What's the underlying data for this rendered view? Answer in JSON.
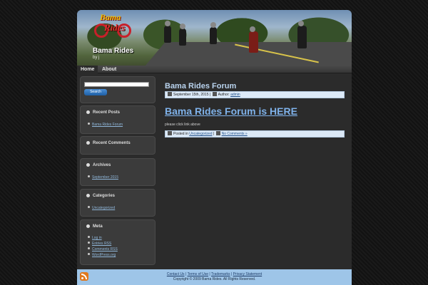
{
  "header": {
    "logo_top": "Bama",
    "logo_bottom": "Rides",
    "site_title": "Bama Rides",
    "site_desc": "by j"
  },
  "nav": {
    "home": "Home",
    "about": "About"
  },
  "search": {
    "value": "",
    "button_label": "Search"
  },
  "sidebar": {
    "recent_posts": {
      "title": "Recent Posts",
      "items": [
        "Bama Rides Forum"
      ]
    },
    "recent_comments": {
      "title": "Recent Comments"
    },
    "archives": {
      "title": "Archives",
      "items": [
        "September 2015"
      ]
    },
    "categories": {
      "title": "Categories",
      "items": [
        "Uncategorized"
      ]
    },
    "meta": {
      "title": "Meta",
      "items": [
        "Log in",
        "Entries RSS",
        "Comments RSS",
        "WordPress.org"
      ]
    }
  },
  "main": {
    "page_title": "Bama Rides Forum",
    "date": "September 15th, 2015",
    "author_label": "Author:",
    "author": "admin",
    "post_title": "Bama Rides Forum is HERE",
    "post_body": "please click link above",
    "posted_in_label": "Posted in",
    "category": "Uncategorized",
    "comments_link": "No Comments »"
  },
  "footer": {
    "links": [
      "Contact Us",
      "Terms of Use",
      "Trademarks",
      "Privacy Statement"
    ],
    "copyright": "Copyright © 2009 Bama Rides. All Rights Reserved."
  },
  "colors": {
    "accent": "#7fb2ea",
    "footer_bg": "#9ec5e8",
    "meta_bg": "#dce9f7"
  }
}
